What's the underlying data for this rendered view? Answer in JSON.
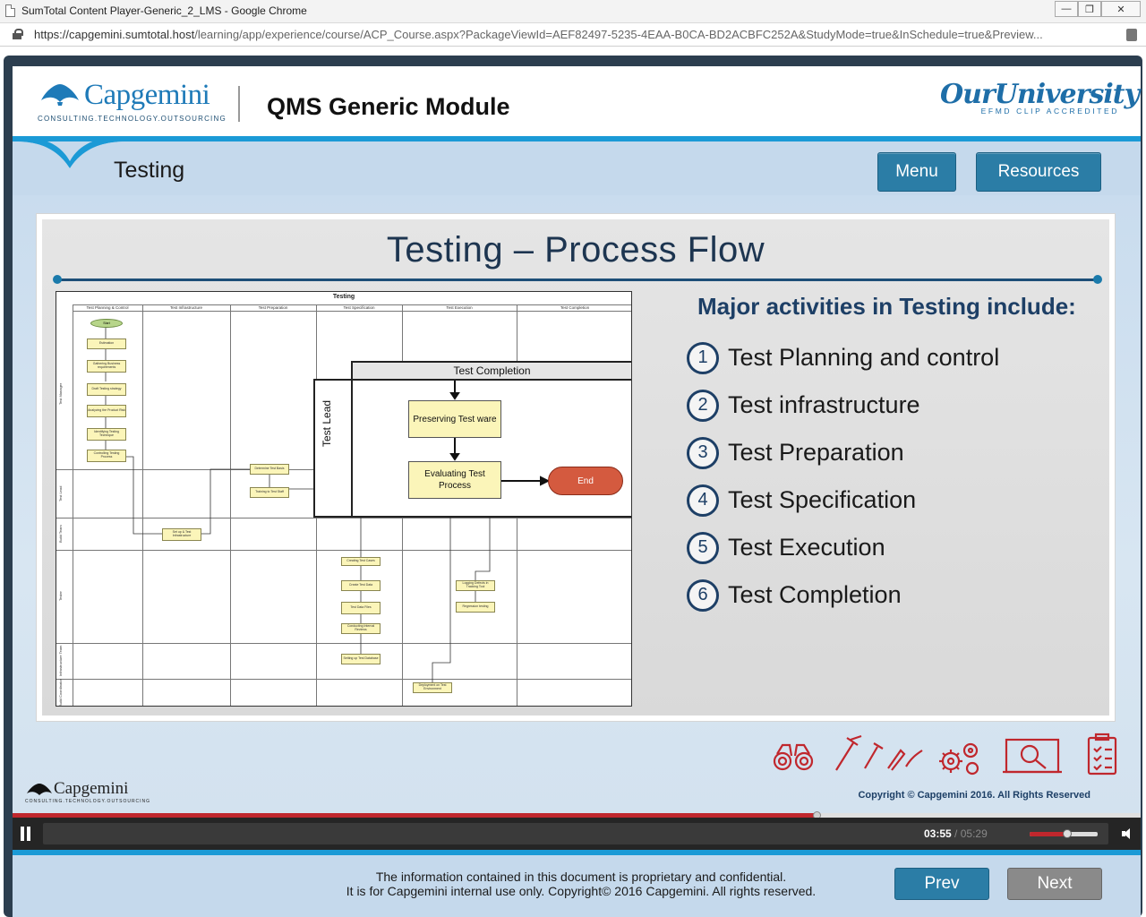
{
  "browser": {
    "tab_title": "SumTotal Content Player-Generic_2_LMS - Google Chrome",
    "url_host": "https://capgemini.sumtotal.host",
    "url_path": "/learning/app/experience/course/ACP_Course.aspx?PackageViewId=AEF82497-5235-4EAA-B0CA-BD2ACBFC252A&StudyMode=true&InSchedule=true&Preview..."
  },
  "header": {
    "logo_name": "Capgemini",
    "logo_tagline": "CONSULTING.TECHNOLOGY.OUTSOURCING",
    "module_title": "QMS Generic Module",
    "university_brand": "OurUniversity",
    "university_accreditation": "EFMD CLIP ACCREDITED"
  },
  "nav": {
    "section_title": "Testing",
    "menu_label": "Menu",
    "resources_label": "Resources"
  },
  "slide": {
    "title": "Testing – Process Flow",
    "diagram": {
      "title": "Testing",
      "columns": [
        "Test Planning & Control",
        "Test Infrastructure",
        "Test Preparation",
        "Test Specification",
        "Test Execution",
        "Test Completion"
      ],
      "lanes": [
        "Test Manager",
        "Test Lead",
        "Build Team",
        "Tester",
        "Infrastructure Team",
        "Build Coordinator"
      ],
      "small_boxes": {
        "start": "Start",
        "b1": "Estimation",
        "b2": "Gathering Business requirements",
        "b3": "Draft Testing strategy",
        "b4": "Analyzing the Product Risk",
        "b5": "Identifying Testing Technique",
        "b6": "Controlling Testing Process",
        "b7": "Set up & Test Infrastructure",
        "b8": "Determine Test Basis",
        "b9": "Training to Test Staff",
        "b10": "Creating Test Cases",
        "b11": "Create Test Data",
        "b12": "Test Data Files",
        "b13": "Conducting Internal Reviews",
        "b14": "Setting up Test Database",
        "b15": "Logging Defects in Tracking Tool",
        "b16": "Regression testing",
        "b17": "Deployment on Test Environment"
      },
      "zoom": {
        "header": "Test Completion",
        "lead_label": "Test Lead",
        "box1": "Preserving Test ware",
        "box2_line1": "Evaluating Test",
        "box2_line2": "Process",
        "end": "End"
      }
    },
    "list_heading": "Major activities in Testing include:",
    "items": [
      {
        "num": "1",
        "text": "Test Planning and control"
      },
      {
        "num": "2",
        "text": "Test infrastructure"
      },
      {
        "num": "3",
        "text": "Test Preparation"
      },
      {
        "num": "4",
        "text": "Test Specification"
      },
      {
        "num": "5",
        "text": "Test Execution"
      },
      {
        "num": "6",
        "text": "Test Completion"
      }
    ]
  },
  "footer": {
    "logo_name": "Capgemini",
    "logo_tagline": "CONSULTING.TECHNOLOGY.OUTSOURCING",
    "copyright": "Copyright © Capgemini 2016. All Rights Reserved"
  },
  "player": {
    "current_time": "03:55",
    "separator": " / ",
    "total_time": "05:29",
    "progress_fraction": 0.713,
    "volume_fraction": 0.55,
    "accent_color": "#c0272d"
  },
  "bottom": {
    "disclaimer_line1": "The information contained in this document is proprietary and confidential.",
    "disclaimer_line2": "It is for Capgemini internal use only. Copyright© 2016 Capgemini. All rights reserved.",
    "prev_label": "Prev",
    "next_label": "Next"
  },
  "icons": [
    "doc-icon",
    "lock-icon",
    "extension-icon",
    "minimize-icon",
    "maximize-icon",
    "close-icon",
    "pause-icon",
    "speaker-icon",
    "binoculars-icon",
    "tools-icon",
    "gears-icon",
    "magnifier-monitor-icon",
    "checklist-icon",
    "spade-logo-icon"
  ],
  "colors": {
    "brand_blue": "#1b9ad6",
    "button_blue": "#2b7da6",
    "title_navy": "#1d3f66",
    "band_light": "#c5d9ec"
  }
}
